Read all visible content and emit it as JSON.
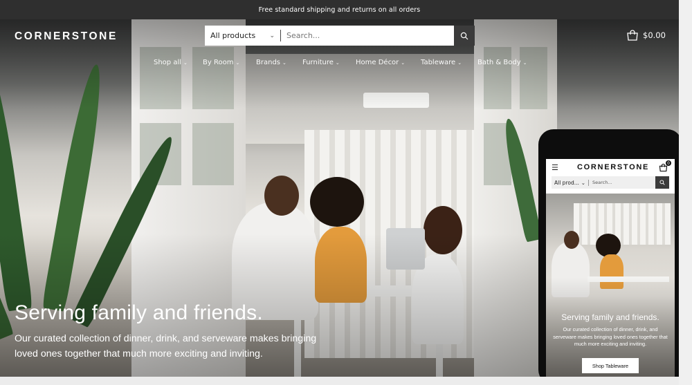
{
  "announcement": "Free standard shipping and returns on all orders",
  "header": {
    "logo": "CORNERSTONE",
    "search": {
      "category": "All products",
      "placeholder": "Search..."
    },
    "cart_total": "$0.00",
    "nav": [
      "Shop all",
      "By Room",
      "Brands",
      "Furniture",
      "Home Décor",
      "Tableware",
      "Bath & Body"
    ]
  },
  "hero": {
    "title": "Serving family and friends.",
    "subtitle": "Our curated collection of dinner, drink, and serveware makes bringing loved ones together that much more exciting and inviting."
  },
  "mobile": {
    "logo": "CORNERSTONE",
    "cart_count": "0",
    "search": {
      "category": "All prod...",
      "placeholder": "Search..."
    },
    "hero_title": "Serving family and friends.",
    "hero_subtitle": "Our curated collection of dinner, drink, and serveware makes bringing loved ones together that much more exciting and inviting.",
    "cta": "Shop Tableware"
  }
}
